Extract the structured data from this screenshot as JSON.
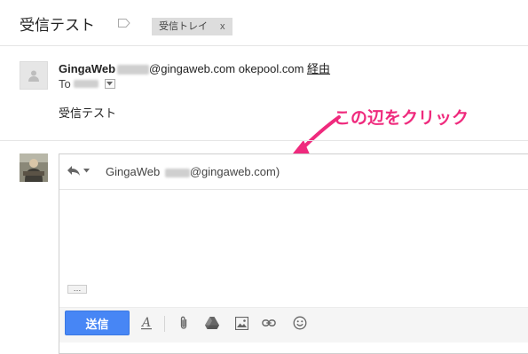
{
  "thread": {
    "subject": "受信テスト",
    "label_name": "受信トレイ",
    "label_remove": "x"
  },
  "message": {
    "sender_name": "GingaWeb",
    "sender_email_suffix": "@gingaweb.com",
    "sender_via_domain": "okepool.com",
    "via_link": "経由",
    "to_label": "To",
    "body": "受信テスト"
  },
  "annotation": {
    "text": "この辺をクリック",
    "color": "#ef2a7d"
  },
  "reply": {
    "recipient_name": "GingaWeb",
    "recipient_email_suffix": "@gingaweb.com)",
    "send_label": "送信",
    "ellipsis": "…",
    "send_color": "#4786f5"
  },
  "icons": [
    "label-tag-icon",
    "avatar-placeholder-icon",
    "reply-arrow-icon",
    "formatting-icon",
    "attach-icon",
    "drive-icon",
    "photo-icon",
    "link-icon",
    "emoji-icon"
  ]
}
